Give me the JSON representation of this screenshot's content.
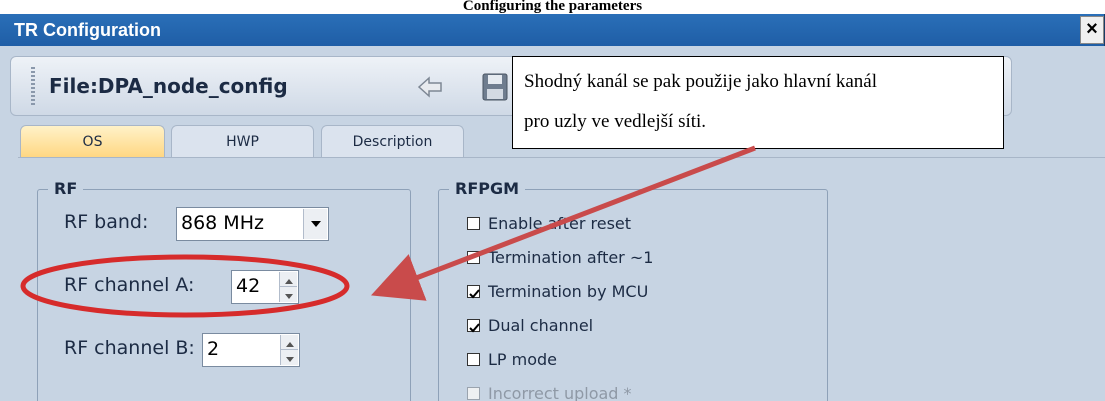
{
  "caption": "Configuring the parameters",
  "window": {
    "title": "TR Configuration",
    "close_glyph": "×"
  },
  "toolbar": {
    "file_label": "File:DPA_node_config",
    "icons": [
      "back-arrow-icon",
      "save-icon"
    ]
  },
  "tabs": [
    {
      "label": "OS",
      "active": true
    },
    {
      "label": "HWP",
      "active": false
    },
    {
      "label": "Description",
      "active": false
    }
  ],
  "rf": {
    "legend": "RF",
    "band_label": "RF band:",
    "band_value": "868 MHz",
    "channel_a_label": "RF channel A:",
    "channel_a_value": "42",
    "channel_b_label": "RF channel B:",
    "channel_b_value": "2"
  },
  "rfpgm": {
    "legend": "RFPGM",
    "options": [
      {
        "label": "Enable after reset",
        "checked": false,
        "enabled": true
      },
      {
        "label": "Termination after ~1",
        "checked": false,
        "enabled": true
      },
      {
        "label": "Termination by MCU",
        "checked": true,
        "enabled": true
      },
      {
        "label": "Dual channel",
        "checked": true,
        "enabled": true
      },
      {
        "label": "LP mode",
        "checked": false,
        "enabled": true
      },
      {
        "label": "Incorrect upload *",
        "checked": false,
        "enabled": false
      }
    ]
  },
  "callout": {
    "line1": "Shodný kanál se pak použije jako hlavní kanál",
    "line2": "pro uzly ve vedlejší síti."
  },
  "annotation_color": "#d62b2b",
  "arrow_color": "#c94b4b"
}
